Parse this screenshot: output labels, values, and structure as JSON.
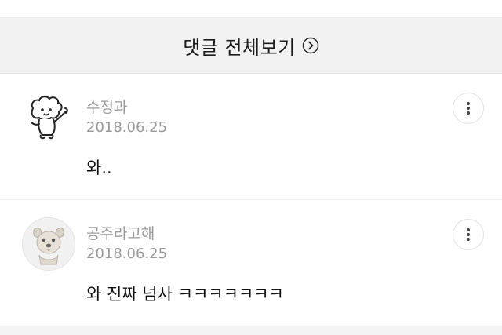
{
  "header": {
    "view_all_label": "댓글 전체보기",
    "view_all_icon": "chevron-right-circle-icon"
  },
  "comments": [
    {
      "username": "수정과",
      "date": "2018.06.25",
      "text": "와..",
      "avatar_icon": "cartoon-puppy-avatar-icon",
      "more_icon": "more-vertical-icon"
    },
    {
      "username": "공주라고해",
      "date": "2018.06.25",
      "text": "와 진짜 넘사 ㅋㅋㅋㅋㅋㅋㅋ",
      "avatar_icon": "dog-photo-avatar-icon",
      "more_icon": "more-vertical-icon"
    }
  ],
  "colors": {
    "header_bg": "#f2f2f2",
    "meta_text": "#9a9a9a",
    "body_text": "#111111"
  }
}
